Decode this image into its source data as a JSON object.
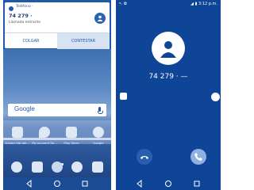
{
  "left_screen": {
    "notification": {
      "app_name": "Teléfono ·",
      "number": "74 279 ·",
      "call_state": "Llamada entrante",
      "decline_label": "COLGAR",
      "answer_label": "CONTESTAR",
      "avatar_icon": "person-icon"
    },
    "search": {
      "logo": "Google",
      "mic_icon": "mic-icon"
    },
    "apps": [
      {
        "label": "Easter tile-ide...",
        "icon": "mail-icon"
      },
      {
        "label": "My account Se...",
        "icon": "map-icon"
      },
      {
        "label": "Play Store",
        "icon": "play-store-icon"
      },
      {
        "label": "Google",
        "icon": "google-icon"
      }
    ],
    "dock": [
      {
        "icon": "phone-icon"
      },
      {
        "icon": "messages-icon"
      },
      {
        "icon": "app-drawer-icon"
      },
      {
        "icon": "browser-icon"
      },
      {
        "icon": "camera-icon"
      }
    ],
    "nav": [
      "back-icon",
      "home-icon",
      "recents-icon"
    ]
  },
  "right_screen": {
    "status_left": "↖ ✿",
    "status_right": "◢ ▮ 3:12 p.m.",
    "caller_number": "74 279 · —",
    "avatar_icon": "person-icon",
    "end_call_icon": "end-call-icon",
    "answer_icon": "answer-call-icon",
    "message_icon": "message-icon",
    "timer_icon": "alarm-icon",
    "nav": [
      "back-icon",
      "home-icon",
      "recents-icon"
    ]
  },
  "colors": {
    "left_bg": "#1f5aa8",
    "right_bg": "#0e4597",
    "accent": "#ffffff"
  }
}
